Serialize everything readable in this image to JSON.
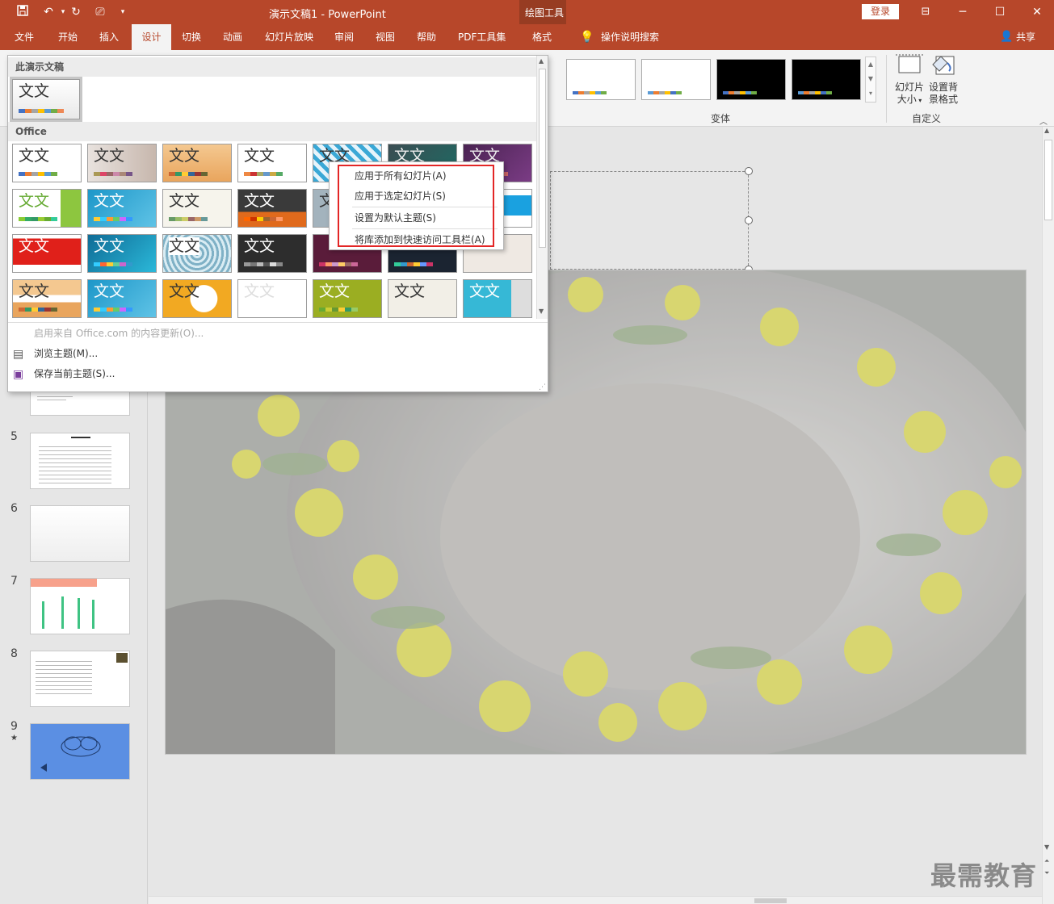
{
  "window": {
    "title": "演示文稿1  -  PowerPoint",
    "context_group": "绘图工具",
    "login_label": "登录",
    "share_label": "共享"
  },
  "tabs": [
    "文件",
    "开始",
    "插入",
    "设计",
    "切换",
    "动画",
    "幻灯片放映",
    "审阅",
    "视图",
    "帮助",
    "PDF工具集"
  ],
  "active_tab": "设计",
  "context_tab": "格式",
  "tell_me": "操作说明搜索",
  "ribbon": {
    "variants_group": "变体",
    "customize_group": "自定义",
    "slide_size_label_1": "幻灯片",
    "slide_size_label_2": "大小",
    "bg_format_label_1": "设置背",
    "bg_format_label_2": "景格式"
  },
  "gallery": {
    "section_current": "此演示文稿",
    "section_office": "Office",
    "theme_text": "文文",
    "menu_update": "启用来自 Office.com 的内容更新(O)...",
    "menu_browse": "浏览主题(M)...",
    "menu_save": "保存当前主题(S)..."
  },
  "context_menu": {
    "apply_all": "应用于所有幻灯片(A)",
    "apply_selected": "应用于选定幻灯片(S)",
    "set_default": "设置为默认主题(S)",
    "add_to_qat": "将库添加到快速访问工具栏(A)"
  },
  "slides": {
    "numbers": [
      "5",
      "6",
      "7",
      "8",
      "9"
    ],
    "star": "★"
  },
  "watermark": "最需教育",
  "colors": {
    "accent": "#b7472a",
    "highlight_box": "#e32626"
  }
}
